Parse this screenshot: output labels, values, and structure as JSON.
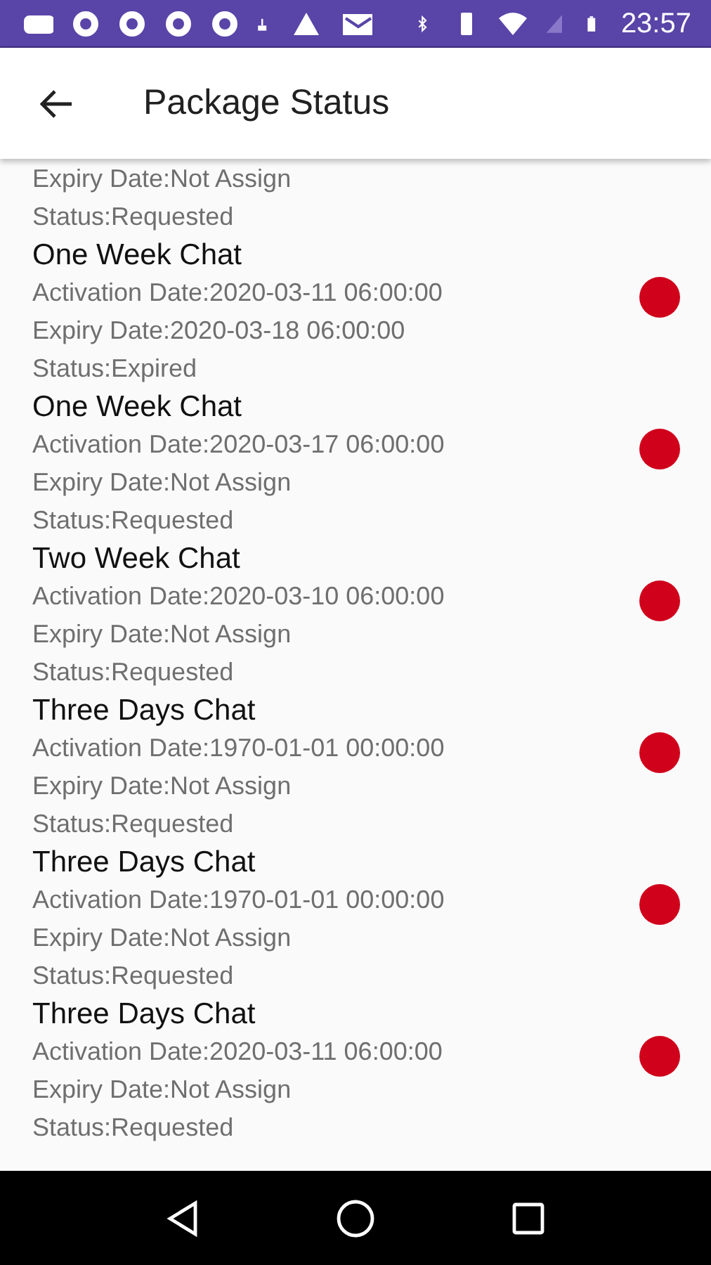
{
  "status_bar": {
    "time": "23:57"
  },
  "app_bar": {
    "title": "Package Status"
  },
  "partial_item": {
    "expiry": "Expiry Date:Not Assign",
    "status": "Status:Requested"
  },
  "packages": [
    {
      "name": "One Week Chat",
      "activation": "Activation Date:2020-03-11 06:00:00",
      "expiry": "Expiry Date:2020-03-18 06:00:00",
      "status": "Status:Expired",
      "color": "#d0021b"
    },
    {
      "name": "One Week Chat",
      "activation": "Activation Date:2020-03-17 06:00:00",
      "expiry": "Expiry Date:Not Assign",
      "status": "Status:Requested",
      "color": "#d0021b"
    },
    {
      "name": "Two Week Chat",
      "activation": "Activation Date:2020-03-10 06:00:00",
      "expiry": "Expiry Date:Not Assign",
      "status": "Status:Requested",
      "color": "#d0021b"
    },
    {
      "name": "Three Days Chat",
      "activation": "Activation Date:1970-01-01 00:00:00",
      "expiry": "Expiry Date:Not Assign",
      "status": "Status:Requested",
      "color": "#d0021b"
    },
    {
      "name": "Three Days Chat",
      "activation": "Activation Date:1970-01-01 00:00:00",
      "expiry": "Expiry Date:Not Assign",
      "status": "Status:Requested",
      "color": "#d0021b"
    },
    {
      "name": "Three Days Chat",
      "activation": "Activation Date:2020-03-11 06:00:00",
      "expiry": "Expiry Date:Not Assign",
      "status": "Status:Requested",
      "color": "#d0021b"
    }
  ]
}
